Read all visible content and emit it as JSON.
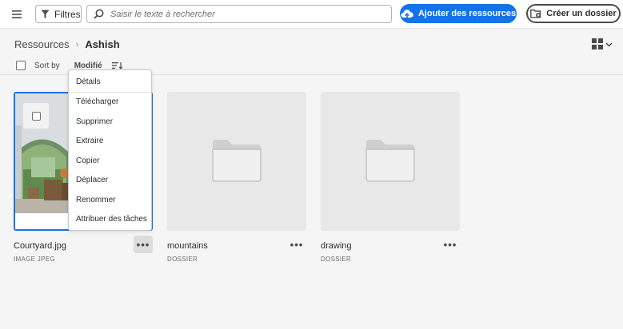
{
  "topbar": {
    "menu_icon": "hamburger-icon",
    "filter_label": "Filtres",
    "search_placeholder": "Saisir le texte à rechercher",
    "add_label": "Ajouter des ressources",
    "create_folder_label": "Créer un dossier",
    "accent_color": "#1473e6"
  },
  "breadcrumb": {
    "root": "Ressources",
    "separator": "›",
    "current": "Ashish"
  },
  "sortbar": {
    "sort_by_label": "Sort by",
    "sort_value": "Modifié"
  },
  "cards": [
    {
      "name": "Courtyard.jpg",
      "type": "IMAGE JPEG",
      "more": "•••",
      "selected": true
    },
    {
      "name": "mountains",
      "type": "DOSSIER",
      "more": "•••"
    },
    {
      "name": "drawing",
      "type": "DOSSIER",
      "more": "•••"
    }
  ],
  "context_menu": {
    "items": [
      "Détails",
      "Télécharger",
      "Supprimer",
      "Extraire",
      "Copier",
      "Déplacer",
      "Renommer",
      "Attribuer des tâches"
    ]
  }
}
